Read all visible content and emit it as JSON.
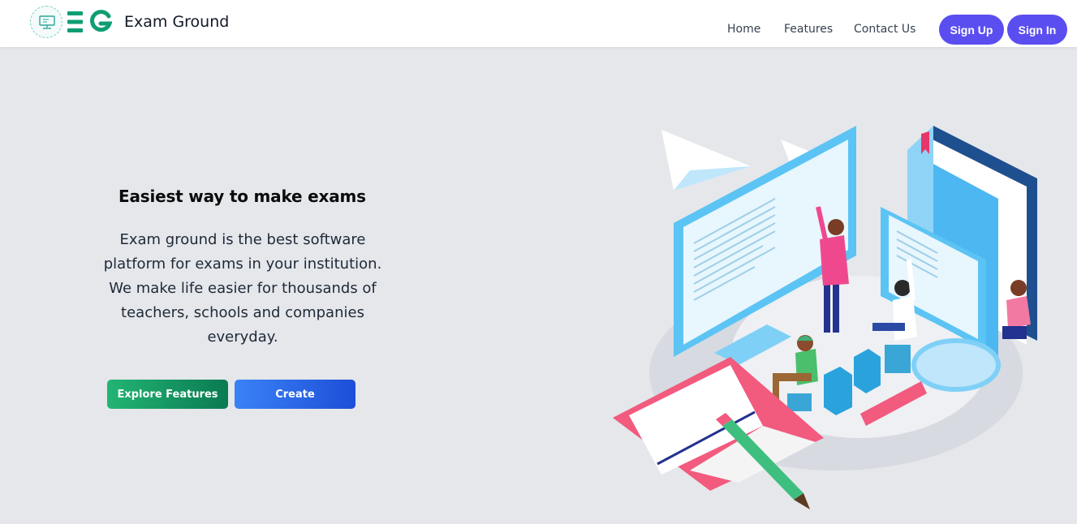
{
  "brand": {
    "name": "Exam Ground",
    "logo_letters": "EG"
  },
  "nav": {
    "links": [
      "Home",
      "Features",
      "Contact Us"
    ],
    "sign_up": "Sign Up",
    "sign_in": "Sign In"
  },
  "hero": {
    "title": "Easiest way to make exams",
    "description": "Exam ground is the best software platform for exams in your institution. We make life easier for thousands of teachers, schools and companies everyday.",
    "primary_cta": "Explore Features",
    "secondary_cta": "Create"
  },
  "colors": {
    "accent": "#5b4ef0",
    "brand_green": "#0f9d73",
    "background": "#e5e7eb"
  },
  "icons": [
    "logo-monitor-icon",
    "hero-illustration"
  ]
}
